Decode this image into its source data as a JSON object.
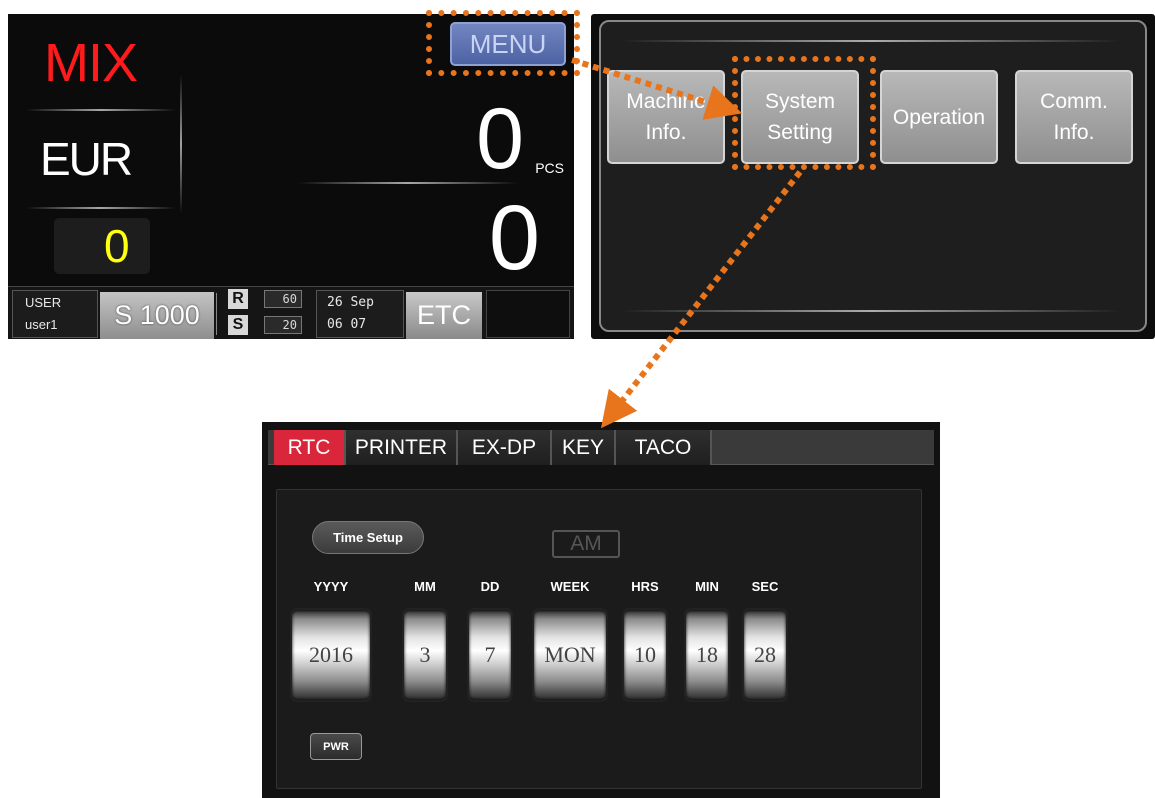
{
  "main_screen": {
    "mode": "MIX",
    "currency": "EUR",
    "denomination": "0",
    "count": "0",
    "count_unit": "PCS",
    "amount": "0",
    "menu_label": "MENU",
    "status": {
      "user_label": "USER",
      "user_name": "user1",
      "preset": "S 1000",
      "r_tag": "R",
      "r_value": "60",
      "s_tag": "S",
      "s_value": "20",
      "date_line1": "26 Sep",
      "date_line2": "06  07",
      "etc_label": "ETC"
    }
  },
  "menu_screen": {
    "items": [
      {
        "label": "Machine\nInfo."
      },
      {
        "label": "System\nSetting"
      },
      {
        "label": "Operation"
      },
      {
        "label": "Comm.\nInfo."
      }
    ]
  },
  "rtc_screen": {
    "tabs": [
      {
        "label": "RTC",
        "active": true
      },
      {
        "label": "PRINTER"
      },
      {
        "label": "EX-DP"
      },
      {
        "label": "KEY"
      },
      {
        "label": "TACO"
      }
    ],
    "time_setup_label": "Time Setup",
    "ampm": "AM",
    "fields": [
      {
        "label": "YYYY",
        "value": "2016"
      },
      {
        "label": "MM",
        "value": "3"
      },
      {
        "label": "DD",
        "value": "7"
      },
      {
        "label": "WEEK",
        "value": "MON"
      },
      {
        "label": "HRS",
        "value": "10"
      },
      {
        "label": "MIN",
        "value": "18"
      },
      {
        "label": "SEC",
        "value": "28"
      }
    ],
    "pwr_label": "PWR"
  },
  "colors": {
    "mode": "#ff1b1b",
    "denomination": "#ffff10",
    "menu_button": "#5d71b1",
    "active_tab": "#d9263a",
    "annotation": "#e8741c"
  }
}
